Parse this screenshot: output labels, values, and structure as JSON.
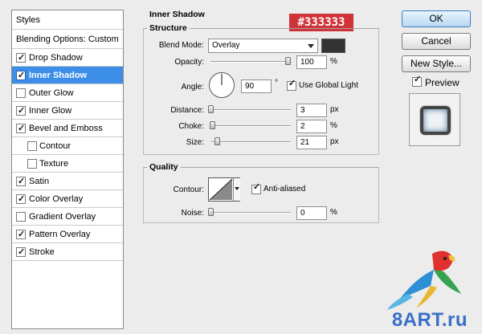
{
  "styles_panel": {
    "header": "Styles",
    "blending": "Blending Options: Custom",
    "items": [
      {
        "label": "Drop Shadow",
        "checked": true
      },
      {
        "label": "Inner Shadow",
        "checked": true,
        "selected": true
      },
      {
        "label": "Outer Glow",
        "checked": false
      },
      {
        "label": "Inner Glow",
        "checked": true
      },
      {
        "label": "Bevel and Emboss",
        "checked": true
      },
      {
        "label": "Contour",
        "checked": false,
        "indent": true
      },
      {
        "label": "Texture",
        "checked": false,
        "indent": true
      },
      {
        "label": "Satin",
        "checked": true
      },
      {
        "label": "Color Overlay",
        "checked": true
      },
      {
        "label": "Gradient Overlay",
        "checked": false
      },
      {
        "label": "Pattern Overlay",
        "checked": true
      },
      {
        "label": "Stroke",
        "checked": true
      }
    ]
  },
  "inner_shadow": {
    "title": "Inner Shadow",
    "structure": {
      "title": "Structure",
      "blend_mode_label": "Blend Mode:",
      "blend_mode_value": "Overlay",
      "color_hex": "#333333",
      "opacity_label": "Opacity:",
      "opacity_value": "100",
      "opacity_unit": "%",
      "opacity_fraction": 1.0,
      "angle_label": "Angle:",
      "angle_value": "90",
      "angle_unit": "°",
      "use_global_light_label": "Use Global Light",
      "use_global_light": true,
      "distance_label": "Distance:",
      "distance_value": "3",
      "distance_unit": "px",
      "distance_fraction": 0.0,
      "choke_label": "Choke:",
      "choke_value": "2",
      "choke_unit": "%",
      "choke_fraction": 0.02,
      "size_label": "Size:",
      "size_value": "21",
      "size_unit": "px",
      "size_fraction": 0.085
    },
    "quality": {
      "title": "Quality",
      "contour_label": "Contour:",
      "anti_aliased_label": "Anti-aliased",
      "anti_aliased": true,
      "noise_label": "Noise:",
      "noise_value": "0",
      "noise_unit": "%",
      "noise_fraction": 0.0
    }
  },
  "annotation": "#333333",
  "buttons": {
    "ok": "OK",
    "cancel": "Cancel",
    "new_style": "New Style...",
    "preview": "Preview",
    "preview_checked": true
  },
  "watermark": "8ART.ru",
  "colors": {
    "selected_row": "#3d8ee8",
    "annotation_bg": "#d13438",
    "swatch": "#333333"
  }
}
